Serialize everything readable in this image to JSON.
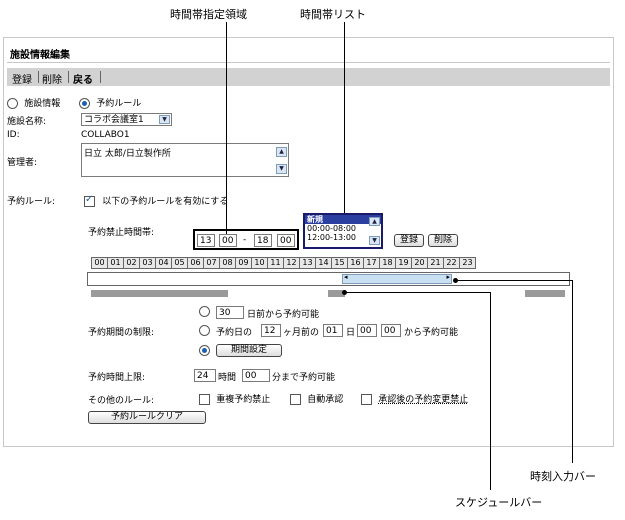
{
  "callouts": {
    "time_area": "時間帯指定領域",
    "time_list": "時間帯リスト",
    "time_input_bar": "時刻入力バー",
    "schedule_bar": "スケジュールバー"
  },
  "page_title": "施設情報編集",
  "toolbar": {
    "register": "登録",
    "delete": "削除",
    "back": "戻る"
  },
  "tabs": {
    "facility_info": "施設情報",
    "reservation_rule": "予約ルール"
  },
  "facility": {
    "name_label": "施設名称:",
    "name_value": "コラボ会議室1",
    "id_label": "ID:",
    "id_value": "COLLABO1",
    "admin_label": "管理者:",
    "admin_value": "日立 太郎/日立製作所"
  },
  "rule": {
    "label": "予約ルール:",
    "enable_text": "以下の予約ルールを有効にする",
    "ban_time_label": "予約禁止時間帯:",
    "time_from_h": "13",
    "time_from_m": "00",
    "time_sep": "-",
    "time_to_h": "18",
    "time_to_m": "00",
    "list_items": [
      "新規",
      "00:00-08:00",
      "12:00-13:00"
    ],
    "register_btn": "登録",
    "delete_btn": "削除",
    "hours": [
      "00",
      "01",
      "02",
      "03",
      "04",
      "05",
      "06",
      "07",
      "08",
      "09",
      "10",
      "11",
      "12",
      "13",
      "14",
      "15",
      "16",
      "17",
      "18",
      "19",
      "20",
      "21",
      "22",
      "23"
    ],
    "period_label": "予約期間の制限:",
    "period_days": "30",
    "period_days_text": "日前から予約可能",
    "period_prefix": "予約日の",
    "period_month": "12",
    "period_month_text": "ヶ月前の",
    "period_day": "01",
    "period_day_text": "日",
    "period_hour": "00",
    "period_min": "00",
    "period_suffix": "から予約可能",
    "period_setting_btn": "期間設定",
    "upper_label": "予約時間上限:",
    "upper_hours": "24",
    "upper_hours_text": "時間",
    "upper_min": "00",
    "upper_min_text": "分まで予約可能",
    "other_label": "その他のルール:",
    "opt_dup": "重複予約禁止",
    "opt_auto": "自動承認",
    "opt_change": "承認後の予約変更禁止",
    "clear_btn": "予約ルールクリア"
  }
}
